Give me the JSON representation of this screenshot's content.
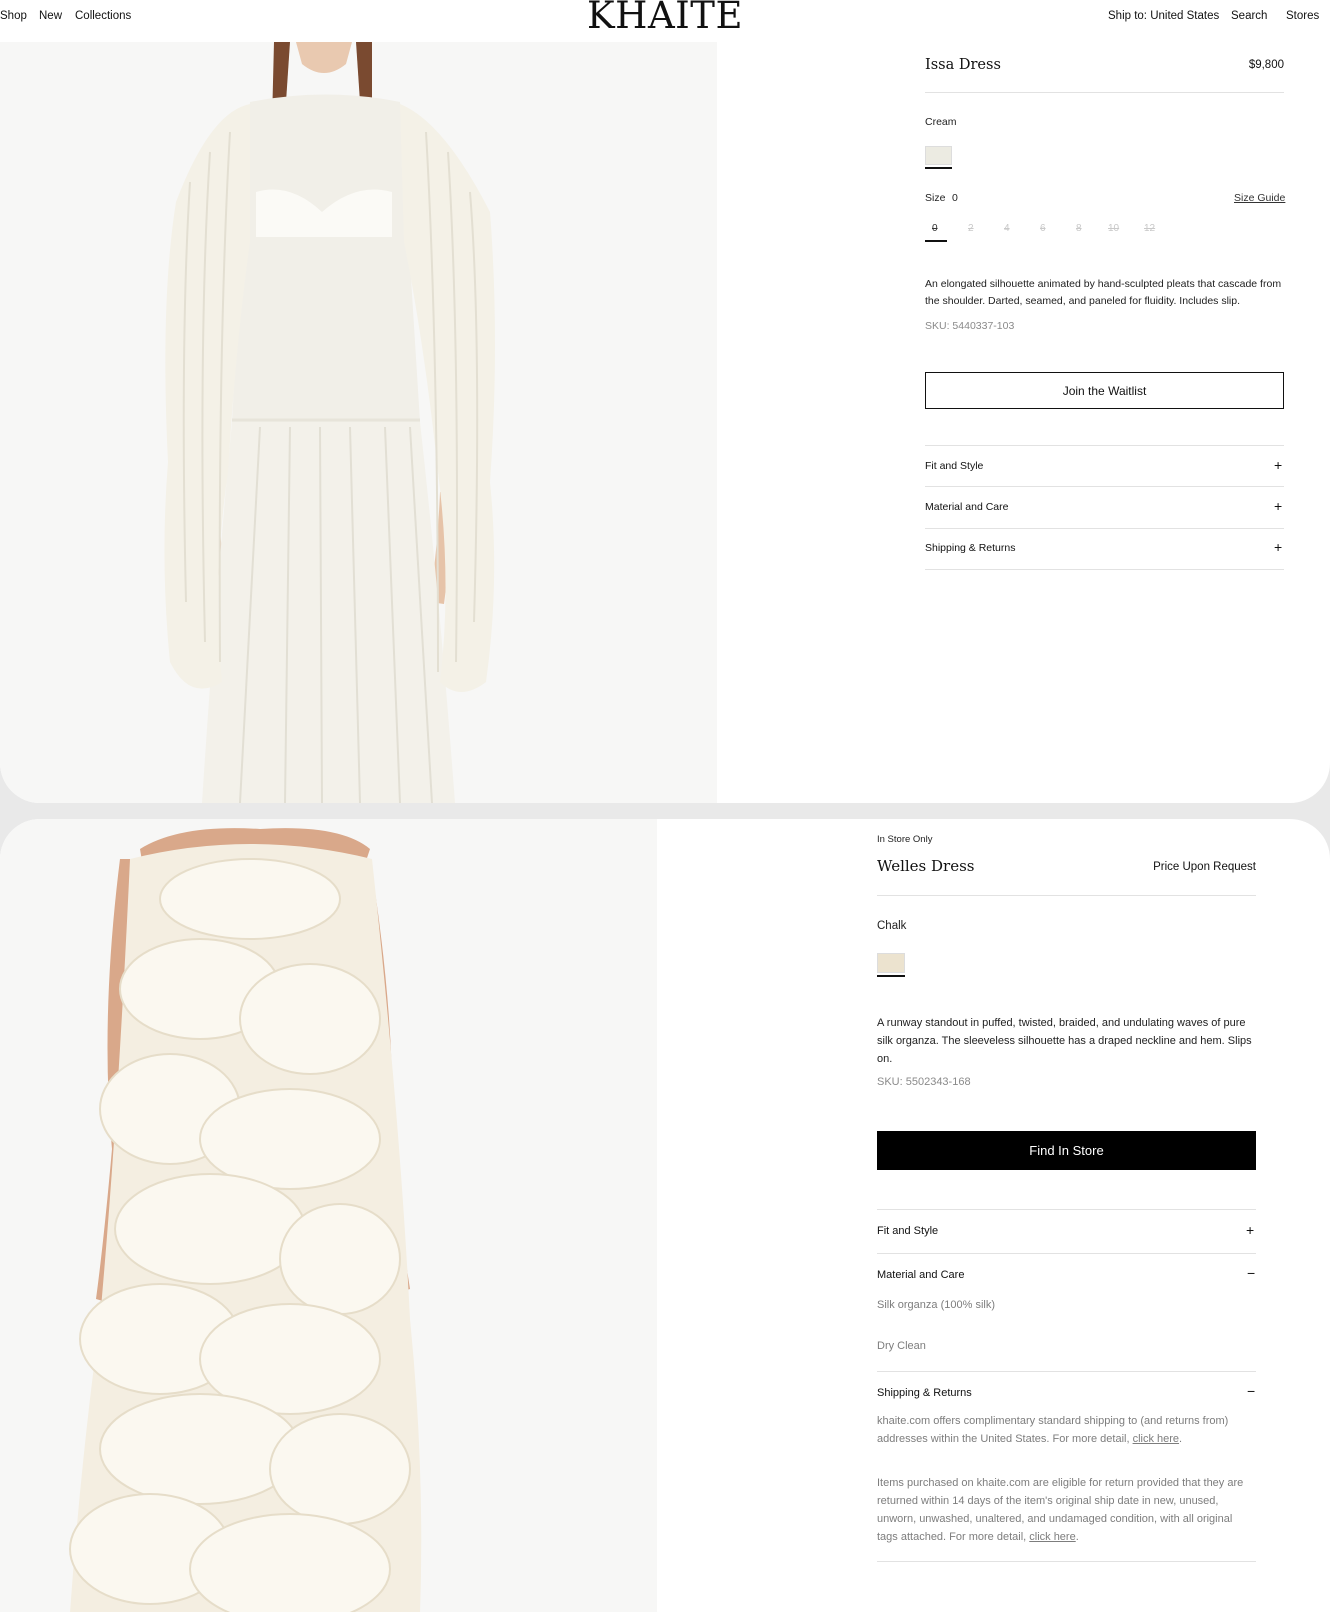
{
  "nav": {
    "left_links": [
      "Shop",
      "New",
      "Collections"
    ],
    "logo": "KHAITE",
    "ship_to": "Ship to: United States",
    "search": "Search",
    "stores": "Stores"
  },
  "product1": {
    "name": "Issa Dress",
    "price": "$9,800",
    "color_label": "Cream",
    "size_label": "Size",
    "size_value": "0",
    "size_guide": "Size Guide",
    "sizes": [
      "0",
      "2",
      "4",
      "6",
      "8",
      "10",
      "12"
    ],
    "description": "An elongated silhouette animated by hand-sculpted pleats that cascade from the shoulder. Darted, seamed, and paneled for fluidity. Includes slip.",
    "sku": "SKU: 5440337-103",
    "cta": "Join the Waitlist",
    "accordion": [
      "Fit and Style",
      "Material and Care",
      "Shipping & Returns"
    ],
    "colors": {
      "swatch": "#ecebe2"
    }
  },
  "product2": {
    "availability": "In Store Only",
    "name": "Welles Dress",
    "price": "Price Upon Request",
    "color_label": "Chalk",
    "description": "A runway standout in puffed, twisted, braided, and undulating waves of pure silk organza. The sleeveless silhouette has a draped neckline and hem. Slips on.",
    "sku": "SKU: 5502343-168",
    "cta": "Find In Store",
    "accordion": {
      "fit": "Fit and Style",
      "material": "Material and Care",
      "material_lines": [
        "Silk organza (100% silk)",
        "Dry Clean"
      ],
      "shipping": "Shipping & Returns",
      "shipping_p1": "khaite.com offers complimentary standard shipping to (and returns from) addresses within the United States. For more detail, ",
      "shipping_p2": "Items purchased on khaite.com are eligible for return provided that they are returned within 14 days of the item's original ship date in new, unused, unworn, unwashed, unaltered, and undamaged condition, with all original tags attached. For more detail, ",
      "click_here": "click here",
      "period": "."
    },
    "colors": {
      "swatch": "#ece3cf"
    }
  }
}
